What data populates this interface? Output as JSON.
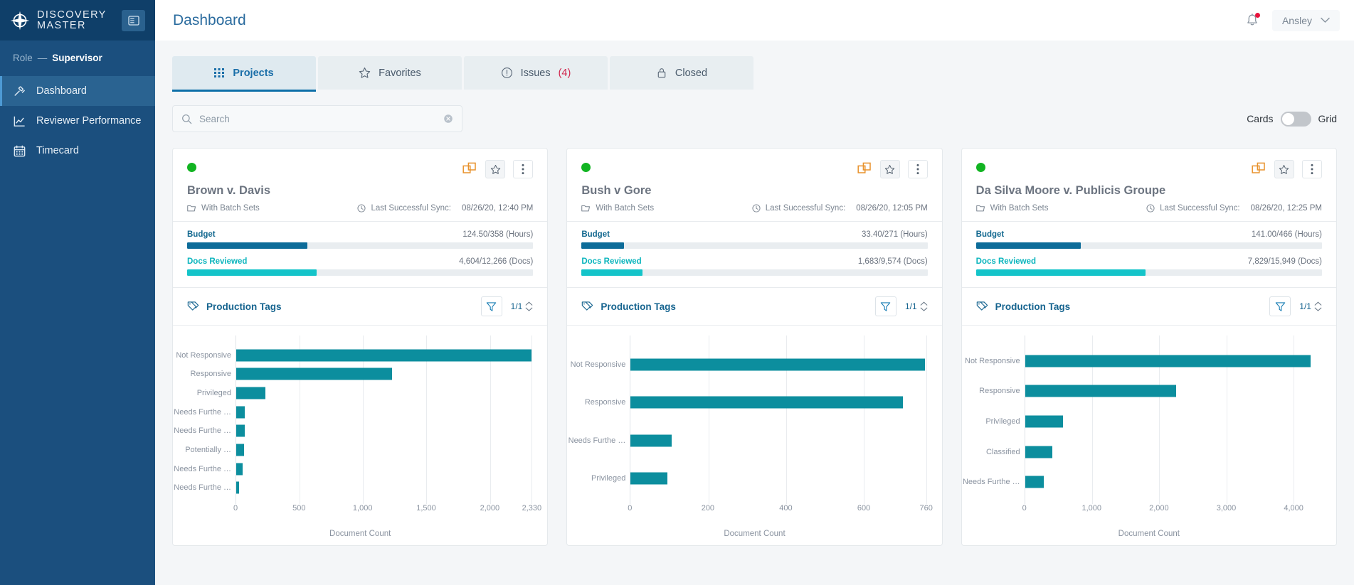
{
  "brand": {
    "line1": "DISCOVERY",
    "line2": "MASTER",
    "logo_icon": "compass-rose-icon",
    "collapse_icon": "collapse-sidebar-icon"
  },
  "sidebar": {
    "role_label": "Role",
    "role_dash": "—",
    "role_value": "Supervisor",
    "items": [
      {
        "label": "Dashboard",
        "icon": "gavel-icon",
        "active": true
      },
      {
        "label": "Reviewer Performance",
        "icon": "chart-line-icon",
        "active": false
      },
      {
        "label": "Timecard",
        "icon": "calendar-icon",
        "active": false
      }
    ]
  },
  "header": {
    "title": "Dashboard",
    "notification_icon": "bell-icon",
    "notification_has_alert": true,
    "user_name": "Ansley",
    "user_chevron_icon": "chevron-down-icon"
  },
  "tabs": [
    {
      "label": "Projects",
      "icon": "grid-dots-icon",
      "badge": "",
      "active": true
    },
    {
      "label": "Favorites",
      "icon": "star-icon",
      "badge": "",
      "active": false
    },
    {
      "label": "Issues",
      "icon": "alert-circle-icon",
      "badge": "(4)",
      "active": false
    },
    {
      "label": "Closed",
      "icon": "lock-icon",
      "badge": "",
      "active": false
    }
  ],
  "search": {
    "placeholder": "Search",
    "value": "",
    "search_icon": "search-icon",
    "clear_icon": "clear-circle-icon"
  },
  "view_toggle": {
    "left_label": "Cards",
    "right_label": "Grid",
    "selected": "Cards"
  },
  "colors": {
    "accent_blue": "#0d6fa8",
    "budget_bar": "#0d6c99",
    "docs_bar": "#14c4c9",
    "chart_bar": "#0c8e9e",
    "status_green": "#12b422",
    "badge_red": "#d1294f",
    "sidebar_bg": "#1b4f7e"
  },
  "section_labels": {
    "budget": "Budget",
    "docs_reviewed": "Docs Reviewed",
    "production_tags": "Production Tags",
    "with_batch_sets": "With Batch Sets",
    "last_sync": "Last Successful Sync:",
    "tags_icon": "tags-icon",
    "filter_icon": "filter-icon",
    "folder_icon": "folder-icon",
    "clock_icon": "clock-icon",
    "copy_icon": "duplicate-icon",
    "star_icon": "star-icon",
    "more_icon": "more-vertical-icon"
  },
  "cards": [
    {
      "status": "green",
      "title": "Brown v. Davis",
      "batch_sets": "With Batch Sets",
      "sync_label": "Last Successful Sync:",
      "sync_time": "08/26/20, 12:40 PM",
      "budget_value": "124.50/358 (Hours)",
      "budget_pct": 34.8,
      "docs_value": "4,604/12,266 (Docs)",
      "docs_pct": 37.5,
      "pager": "1/1",
      "chart_data": {
        "type": "bar",
        "orientation": "horizontal",
        "title": "Production Tags",
        "xlabel": "Document Count",
        "ylabel": "",
        "categories": [
          "Not Responsive",
          "Responsive",
          "Privileged",
          "Needs Furthe …",
          "Needs Furthe …",
          "Potentially  …",
          "Needs Furthe …",
          "Needs Furthe …"
        ],
        "values": [
          2330,
          1230,
          230,
          70,
          65,
          62,
          48,
          22
        ],
        "xticks": [
          "0",
          "500",
          "1,000",
          "1,500",
          "2,000",
          "2,330"
        ],
        "xtick_values": [
          0,
          500,
          1000,
          1500,
          2000,
          2330
        ],
        "xlim": [
          0,
          2330
        ],
        "grid": true
      }
    },
    {
      "status": "green",
      "title": "Bush v Gore",
      "batch_sets": "With Batch Sets",
      "sync_label": "Last Successful Sync:",
      "sync_time": "08/26/20, 12:05 PM",
      "budget_value": "33.40/271 (Hours)",
      "budget_pct": 12.3,
      "docs_value": "1,683/9,574 (Docs)",
      "docs_pct": 17.6,
      "pager": "1/1",
      "chart_data": {
        "type": "bar",
        "orientation": "horizontal",
        "title": "Production Tags",
        "xlabel": "Document Count",
        "ylabel": "",
        "categories": [
          "Not Responsive",
          "Responsive",
          "Needs Furthe …",
          "Privileged"
        ],
        "values": [
          757,
          700,
          105,
          95
        ],
        "xticks": [
          "0",
          "200",
          "400",
          "600",
          "760"
        ],
        "xtick_values": [
          0,
          200,
          400,
          600,
          760
        ],
        "xlim": [
          0,
          760
        ],
        "grid": true
      }
    },
    {
      "status": "green",
      "title": "Da Silva Moore v. Publicis Groupe",
      "batch_sets": "With Batch Sets",
      "sync_label": "Last Successful Sync:",
      "sync_time": "08/26/20, 12:25 PM",
      "budget_value": "141.00/466 (Hours)",
      "budget_pct": 30.3,
      "docs_value": "7,829/15,949 (Docs)",
      "docs_pct": 49.1,
      "pager": "1/1",
      "chart_data": {
        "type": "bar",
        "orientation": "horizontal",
        "title": "Production Tags",
        "xlabel": "Document Count",
        "ylabel": "",
        "categories": [
          "Not Responsive",
          "Responsive",
          "Privileged",
          "Classified",
          "Needs Furthe …"
        ],
        "values": [
          4250,
          2250,
          570,
          410,
          280
        ],
        "xticks": [
          "0",
          "1,000",
          "2,000",
          "3,000",
          "4,000"
        ],
        "xtick_values": [
          0,
          1000,
          2000,
          3000,
          4000
        ],
        "xlim": [
          0,
          4400
        ],
        "grid": true
      }
    }
  ]
}
